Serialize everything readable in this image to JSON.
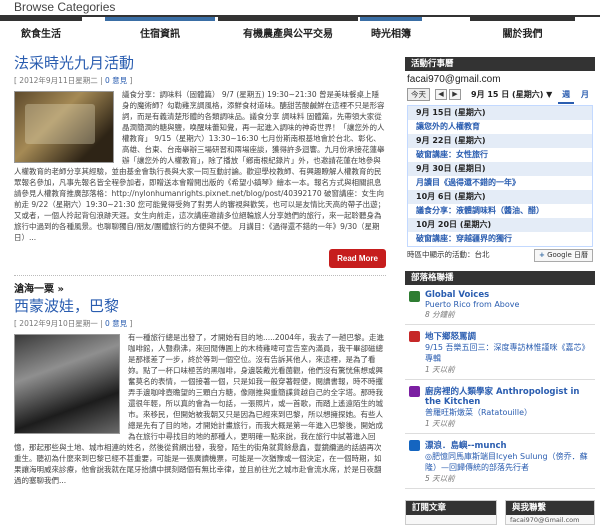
{
  "header": {
    "title": "Browse Categories"
  },
  "categories": [
    {
      "label": "飲食生活"
    },
    {
      "label": "住宿資訊"
    },
    {
      "label": "有機農產與公平交易"
    },
    {
      "label": "時光相簿"
    },
    {
      "label": "關於我們"
    }
  ],
  "posts": [
    {
      "title": "法采時光九月活動",
      "meta_date": "[ 2012年9月11日星期二 | ",
      "meta_comments": "0 意見",
      "meta_end": " ]",
      "body": "議食分享：調味料（固體篇） 9/7 (星期五) 19:30~21:30 曾是美味餐桌上隱身的魔術師？勾勒雞烹調風格，添鮮食材道味。醣甜苦酸鹹鮮在這裡不只是形容詞，而是有義清楚形體的各類調味品。議食分享 調味料 固體篇，先帶領大家從晶潤簡潤的糖與鹽，唤醒味蕾知覺，再一起進入調味的神奇世界！「讓您外的人權教育」 9/15（星期六）13:30~16:30 七月份斯南根基地會於台北、彰化、高雄、台東、台南舉辦三場研習和兩場座談，獲得許多迴響。九月份承接花蓮舉辦「讓您外的人權教育」，除了播放「鄉南根紀錄片」外，也邀請花蓮在地參與人權教育的老師分享其經驗，並由基金會執行長與大家一同互動討論。歡迎學校教師、有興趣瞭解人權教育的民眾報名參加，凡事先報名皆全程參加者，即贈送本會贈閱出版的《希望小鎮琴》繪本一本。報名方式與相關訊息請參見人權教育推廣部落格：http://nylonhumanrights.pixnet.net/blog/post/40392170 破窗講座：女生向前走 9/22（星期六）19:30~21:30 您可能覺得受夠了對男人的審視與歡笑，也可以是友情比天高的帶子出遊；又或者，一個人拎起背包浪跡天涯。女生向前走，這次講座邀請多位絕輪旅人分享她們的旅行，來一起聆聽身為旅行中過到的各種風景。也聊聊獨自/朋友/團體旅行的方便與不便。 月講目：《過得還不錯的一年》9/30（星期日）..."
    },
    {
      "section": "滄海一粟 »",
      "title": "西蒙波娃，巴黎",
      "meta_date": "[ 2012年9月10日星期一 | ",
      "meta_comments": "0 意見",
      "meta_end": " ]",
      "body": "有一種旅行總是出發了，才開始有目的地.....2004年，我去了一趟巴黎。走進咖啡館，人聲鼎沸，來回閒傳圓上的木椅雞啤可宣告室內滿員，我干畢卻磁總是那樣差了一步，終於等到一個空位。沒有告訴其他人，來這裡，是為了看妳。點了一杯口味極苦的黑咖啡，身邊裝戴光看菌觀，他們沒有驚恍焦想或興奮莫名的表情，一個接著一個，只是如我一般穿著輕便，閱讀書報，時不時攫弄手邊咖啡壺瞻望的三顆白方糖，像剛推與重簡諜貨越自己的全字塔。那時我還很年輕，所以真的會為一句話，一張照片，或一首歌，而踏上遙遠陌生的城市。來移民，但開始被我朝又只是因為已經來到巴黎，所以想擁探她。有些人總是先有了目的地，才開始計畫旅行，而我大概是第一年進入巴黎後，開始成為在旅行中尋找目的地的那種人，更明確一點來說，我在旅行中試著進入回憶，那起那些與土地、城市相連的姓名，然後從貧網出發，我發，陌生的街角就貫餘悬鑫，豐鏡纜過的話語再次重生。聽初為什麼來到巴黎已經不甚重要，可能是一張廣讀機票，可能是一次猶豫或一個決定，在一個時期，如果讓海明威來診療，他會說我就在尾牙抬讀中撰刻踏個有無比幸律，並且前往光之城市赴會流水席，於是日夜翻過的塞聊我們..."
    }
  ],
  "read_more_label": "Read More",
  "sidebar": {
    "calendar": {
      "heading": "活動行事曆",
      "email": "facai970@gmail.com",
      "today_label": "今天",
      "prev_label": "◀",
      "next_label": "▶",
      "range": "9月 15 日 (星期六)",
      "dropdown_label": "▼",
      "tab_week": "週",
      "tab_month": "月",
      "rows": [
        {
          "type": "date",
          "text": "9月 15日 (星期六)"
        },
        {
          "type": "event",
          "text": "讓您外的人權教育"
        },
        {
          "type": "date",
          "text": "9月 22日 (星期六)"
        },
        {
          "type": "event",
          "text": "破窗講座：女性旅行"
        },
        {
          "type": "date",
          "text": "9月 30日 (星期日)"
        },
        {
          "type": "event",
          "text": "月讀目《過得還不錯的一年》"
        },
        {
          "type": "date",
          "text": "10月 6日 (星期六)"
        },
        {
          "type": "event",
          "text": "議食分享：液體調味料（醬油、醋）"
        },
        {
          "type": "date",
          "text": "10月 20日 (星期六)"
        },
        {
          "type": "event",
          "text": "破窗講座：穿越疆界的獨行"
        }
      ],
      "tz_label": "時區中顯示的活動：台北",
      "gcal_plus": "+",
      "gcal_label": "Google 日曆"
    },
    "blogroll": {
      "heading": "部落格聯播",
      "items": [
        {
          "source": "Global Voices",
          "link": "Puerto Rico from Above",
          "time": "8 分鐘前",
          "icon_color": "#2e7d32"
        },
        {
          "source": "地下鄉怒罵調",
          "link": "9/15 吾樂五回三：深度專訪林惟謹咪《嘉芯》專輯",
          "time": "1 天以前",
          "icon_color": "#c62828"
        },
        {
          "source": "廚房裡的人類學家 Anthropologist in the Kitchen",
          "link": "普羅旺斯燉菜（Ratatouille）",
          "time": "1 天以前",
          "icon_color": "#7b1fa2"
        },
        {
          "source": "漂浪．島嶼--munch",
          "link": "◎肥憶同馬庫斯端目Icyeh Sulung（傍乔．蘇隆）—回歸傳統的部落先行者",
          "time": "5 天以前",
          "icon_color": "#1565c0"
        }
      ]
    },
    "subscribe_heading": "訂閱文章",
    "contact_heading": "與我聯繫",
    "contact_email": "facai970@Gmail.com"
  }
}
